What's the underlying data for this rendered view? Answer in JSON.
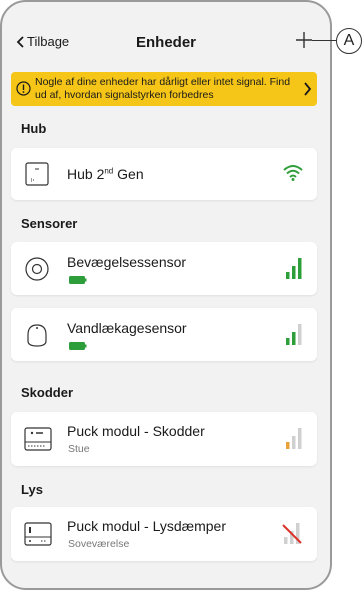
{
  "header": {
    "back_label": "Tilbage",
    "title": "Enheder"
  },
  "callout": {
    "label": "A"
  },
  "banner": {
    "text": "Nogle af dine enheder har dårligt eller intet signal. Find ud af, hvordan signalstyrken forbedres"
  },
  "sections": {
    "hub": "Hub",
    "sensors": "Sensorer",
    "shutters": "Skodder",
    "lights": "Lys"
  },
  "devices": {
    "hub": {
      "name_main": "Hub 2",
      "name_sup": "nd",
      "name_end": " Gen",
      "signal": "wifi-strong"
    },
    "motion": {
      "name": "Bevægelsessensor",
      "battery": "full",
      "signal": "strong"
    },
    "leak": {
      "name": "Vandlækagesensor",
      "battery": "full",
      "signal": "medium"
    },
    "shutter": {
      "name": "Puck modul - Skodder",
      "room": "Stue",
      "signal": "weak"
    },
    "dimmer": {
      "name": "Puck modul - Lysdæmper",
      "room": "Soveværelse",
      "signal": "none"
    }
  },
  "colors": {
    "banner": "#f5c518",
    "signal_good": "#2e9e3a",
    "signal_weak": "#e8a23a",
    "signal_none": "#d9342b",
    "inactive_bar": "#d0d0d0"
  }
}
